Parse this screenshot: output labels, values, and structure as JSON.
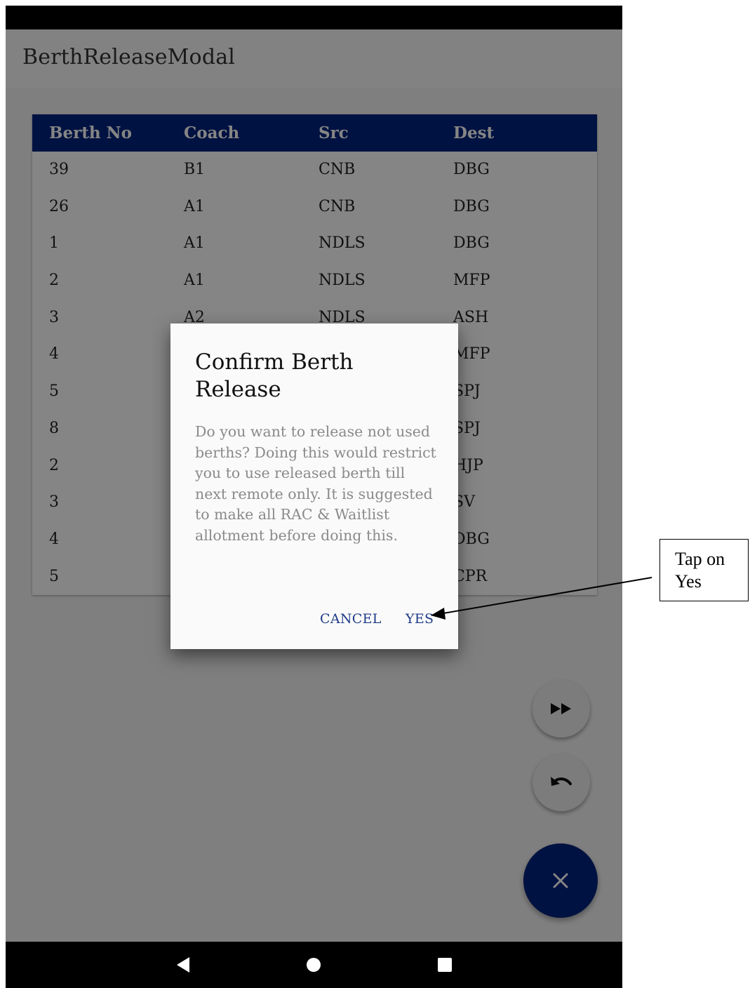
{
  "app": {
    "title": "BerthReleaseModal"
  },
  "table": {
    "headers": [
      "Berth No",
      "Coach",
      "Src",
      "Dest"
    ],
    "rows": [
      [
        "39",
        "B1",
        "CNB",
        "DBG"
      ],
      [
        "26",
        "A1",
        "CNB",
        "DBG"
      ],
      [
        "1",
        "A1",
        "NDLS",
        "DBG"
      ],
      [
        "2",
        "A1",
        "NDLS",
        "MFP"
      ],
      [
        "3",
        "A2",
        "NDLS",
        "ASH"
      ],
      [
        "4",
        "",
        "",
        "MFP"
      ],
      [
        "5",
        "",
        "",
        "SPJ"
      ],
      [
        "8",
        "",
        "",
        "SPJ"
      ],
      [
        "2",
        "",
        "",
        "HJP"
      ],
      [
        "3",
        "",
        "",
        "SV"
      ],
      [
        "4",
        "",
        "",
        "DBG"
      ],
      [
        "5",
        "",
        "",
        "CPR"
      ]
    ]
  },
  "dialog": {
    "title": "Confirm Berth Release",
    "message": "Do you want to release not used berths? Doing this would restrict you to use released berth till next remote only. It is suggested to make all RAC & Waitlist allotment before doing this.",
    "cancel_label": "CANCEL",
    "yes_label": "YES"
  },
  "fabs": {
    "skip_icon": "fast-forward-icon",
    "undo_icon": "undo-icon",
    "close_icon": "close-icon"
  },
  "nav": {
    "back_icon": "back-triangle-icon",
    "home_icon": "home-circle-icon",
    "recents_icon": "recents-square-icon"
  },
  "annotation": {
    "line1": "Tap on",
    "line2": "Yes"
  },
  "colors": {
    "header_bg": "#00247d",
    "fab_primary": "#00247d",
    "dialog_button": "#1f3c88"
  }
}
